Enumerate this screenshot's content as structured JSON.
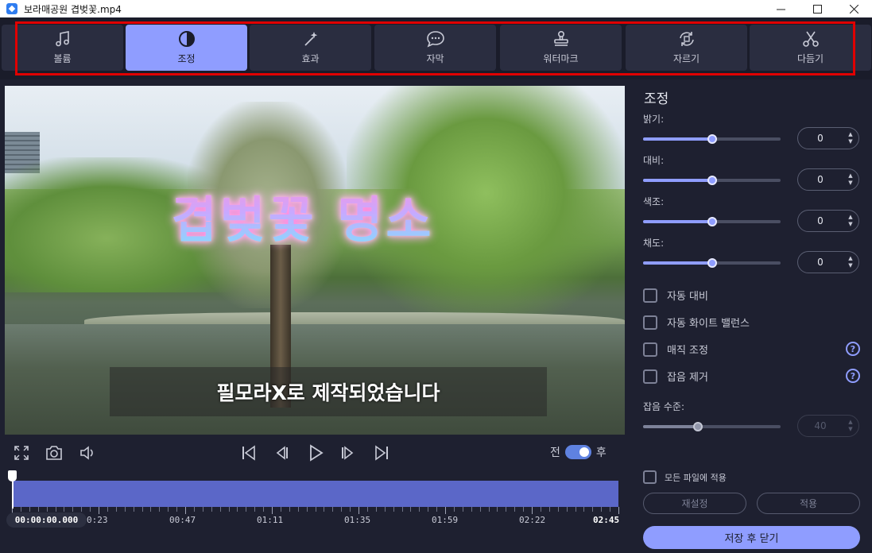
{
  "window": {
    "title": "보라매공원 겹벚꽃.mp4",
    "controls": [
      "minimize-icon",
      "maximize-icon",
      "close-icon"
    ]
  },
  "toolbar": {
    "tabs": [
      {
        "label": "볼륨",
        "icon": "music-note-icon",
        "active": false
      },
      {
        "label": "조정",
        "icon": "contrast-icon",
        "active": true
      },
      {
        "label": "효과",
        "icon": "magic-wand-icon",
        "active": false
      },
      {
        "label": "자막",
        "icon": "speech-bubble-icon",
        "active": false
      },
      {
        "label": "워터마크",
        "icon": "stamp-icon",
        "active": false
      },
      {
        "label": "자르기",
        "icon": "crop-rotate-icon",
        "active": false
      },
      {
        "label": "다듬기",
        "icon": "scissors-icon",
        "active": false
      }
    ],
    "highlight_color": "#e00000",
    "accent_color": "#8f9dff"
  },
  "video": {
    "overlay_title": "겹벚꽃 명소",
    "subtitle": "필모라X로 제작되었습니다"
  },
  "player": {
    "icons": [
      "fullscreen-icon",
      "snapshot-icon",
      "volume-icon",
      "skip-start-icon",
      "step-back-icon",
      "play-icon",
      "step-forward-icon",
      "skip-end-icon"
    ],
    "toggle_before": "전",
    "toggle_after": "후",
    "toggle_on": true,
    "current_time": "00:00:00.000",
    "tick_labels": [
      "0:23",
      "00:47",
      "01:11",
      "01:35",
      "01:59",
      "02:22",
      "02:45"
    ],
    "playhead_fraction": 0
  },
  "panel": {
    "title": "조정",
    "sliders": [
      {
        "label": "밝기:",
        "value": "0",
        "fraction": 0.5
      },
      {
        "label": "대비:",
        "value": "0",
        "fraction": 0.5
      },
      {
        "label": "색조:",
        "value": "0",
        "fraction": 0.5
      },
      {
        "label": "채도:",
        "value": "0",
        "fraction": 0.5
      }
    ],
    "checkboxes": [
      {
        "label": "자동 대비",
        "checked": false,
        "help": false
      },
      {
        "label": "자동 화이트 밸런스",
        "checked": false,
        "help": false
      },
      {
        "label": "매직 조정",
        "checked": false,
        "help": true
      },
      {
        "label": "잡음 제거",
        "checked": false,
        "help": true
      }
    ],
    "noise_level": {
      "label": "잡음 수준:",
      "value": "40",
      "fraction": 0.4,
      "disabled": true
    },
    "apply_all_label": "모든 파일에 적용",
    "reset_label": "재설정",
    "apply_label": "적용",
    "save_close_label": "저장 후 닫기"
  }
}
